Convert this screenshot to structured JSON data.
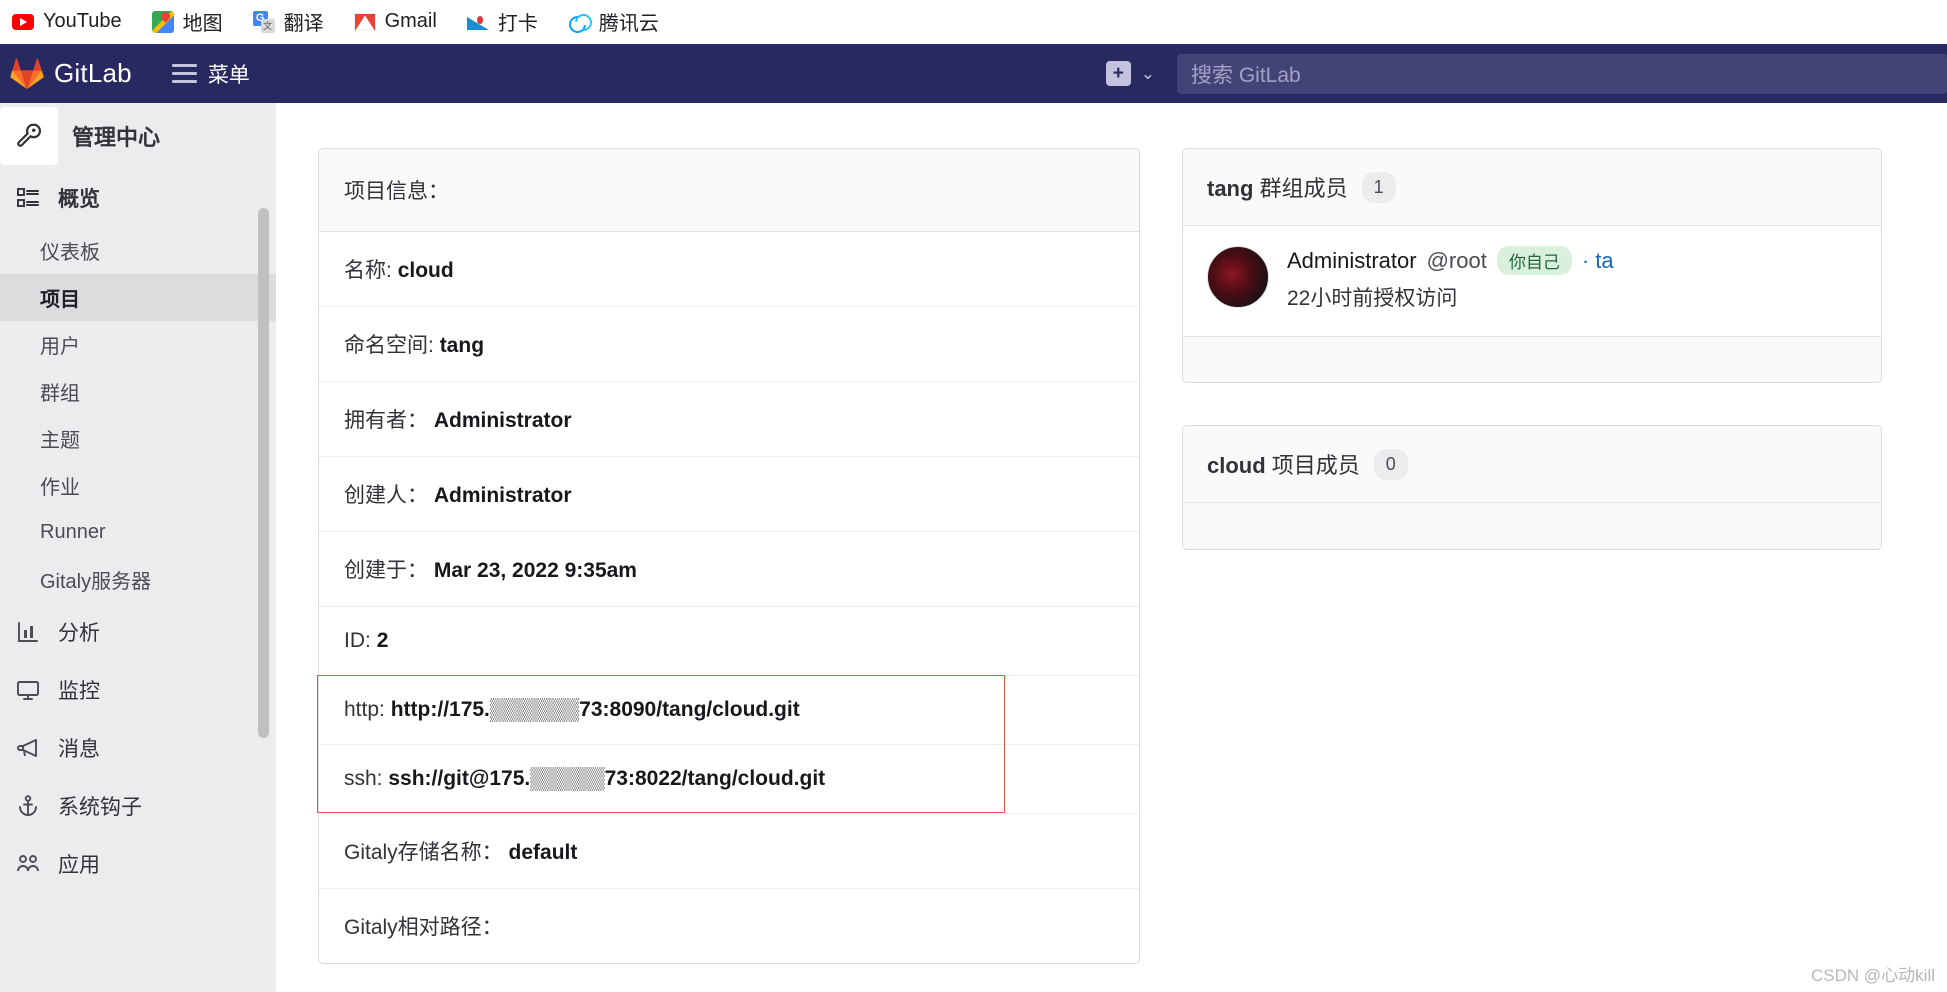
{
  "bookmarks": [
    {
      "label": "YouTube",
      "icon": "youtube-icon"
    },
    {
      "label": "地图",
      "icon": "google-maps-icon"
    },
    {
      "label": "翻译",
      "icon": "google-translate-icon"
    },
    {
      "label": "Gmail",
      "icon": "gmail-icon"
    },
    {
      "label": "打卡",
      "icon": "airline-icon"
    },
    {
      "label": "腾讯云",
      "icon": "tencent-cloud-icon"
    }
  ],
  "navbar": {
    "brand": "GitLab",
    "menu_label": "菜单",
    "plus_label": "+",
    "chevron": "⌄",
    "search_placeholder": "搜索 GitLab",
    "background": "#292961"
  },
  "sidebar": {
    "context_label": "管理中心",
    "context_icon": "wrench-icon",
    "sections": [
      {
        "label": "概览",
        "icon": "overview-icon",
        "bold": true
      },
      {
        "label": "分析",
        "icon": "analytics-icon",
        "bold": false
      },
      {
        "label": "监控",
        "icon": "monitor-icon",
        "bold": false
      },
      {
        "label": "消息",
        "icon": "megaphone-icon",
        "bold": false
      },
      {
        "label": "系统钩子",
        "icon": "anchor-icon",
        "bold": false
      },
      {
        "label": "应用",
        "icon": "applications-icon",
        "bold": false
      }
    ],
    "overview_items": [
      {
        "label": "仪表板",
        "active": false
      },
      {
        "label": "项目",
        "active": true
      },
      {
        "label": "用户",
        "active": false
      },
      {
        "label": "群组",
        "active": false
      },
      {
        "label": "主题",
        "active": false
      },
      {
        "label": "作业",
        "active": false
      },
      {
        "label": "Runner",
        "active": false
      },
      {
        "label": "Gitaly服务器",
        "active": false
      }
    ]
  },
  "project_card": {
    "title": "项目信息：",
    "rows": [
      {
        "label": "名称:",
        "value": "cloud"
      },
      {
        "label": "命名空间:",
        "value": "tang"
      },
      {
        "label": "拥有者：",
        "value": "Administrator"
      },
      {
        "label": "创建人：",
        "value": "Administrator"
      },
      {
        "label": "创建于：",
        "value": "Mar 23, 2022 9:35am"
      },
      {
        "label": "ID:",
        "value": "2"
      },
      {
        "label": "http:",
        "value": "http://175.▒▒▒▒▒▒73:8090/tang/cloud.git"
      },
      {
        "label": "ssh:",
        "value": "ssh://git@175.▒▒▒▒▒73:8022/tang/cloud.git"
      },
      {
        "label": "Gitaly存储名称：",
        "value": "default"
      },
      {
        "label": "Gitaly相对路径：",
        "value": ""
      }
    ],
    "highlight_color": "#e8564a"
  },
  "group_members": {
    "group_name": "tang",
    "title_suffix": " 群组成员",
    "count": "1",
    "member": {
      "name": "Administrator",
      "handle": "@root",
      "self_badge": "你自己",
      "link": "· ta",
      "access_note": "22小时前授权访问"
    }
  },
  "project_members": {
    "project_name": "cloud",
    "title_suffix": " 项目成员",
    "count": "0"
  },
  "watermark": "CSDN @心动kill"
}
